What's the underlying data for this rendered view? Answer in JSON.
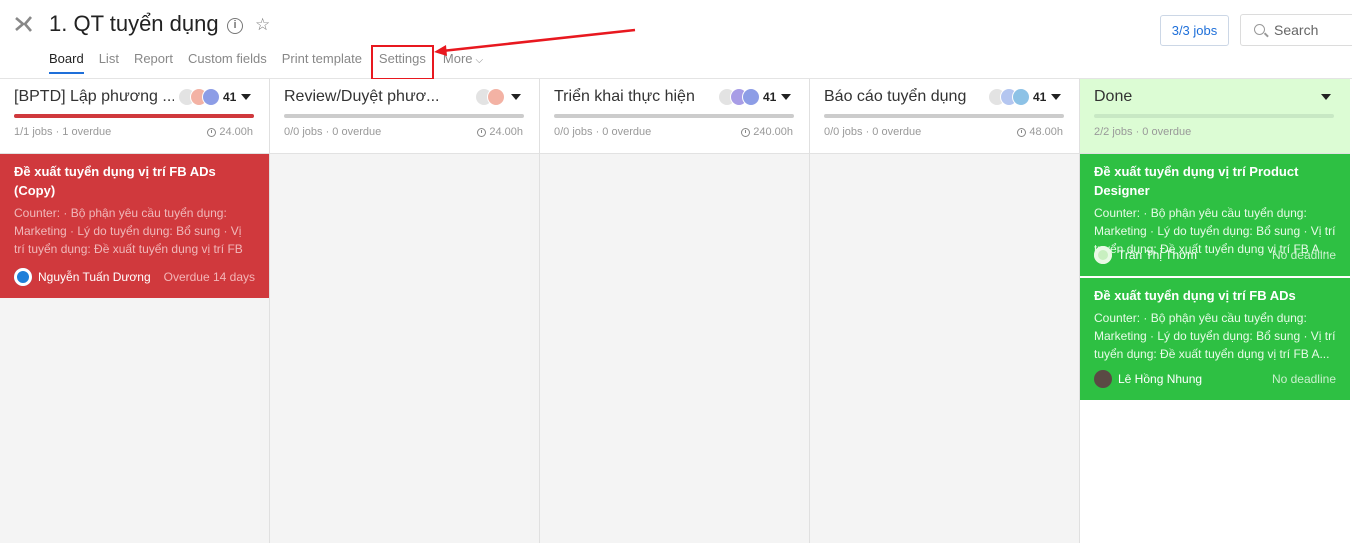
{
  "header": {
    "title": "1. QT tuyển dụng",
    "info_icon": "info-icon",
    "star_icon": "star-icon",
    "tabs": [
      {
        "label": "Board",
        "active": true
      },
      {
        "label": "List"
      },
      {
        "label": "Report"
      },
      {
        "label": "Custom fields"
      },
      {
        "label": "Print template"
      },
      {
        "label": "Settings"
      },
      {
        "label": "More"
      }
    ],
    "jobs_button": "3/3 jobs",
    "search_placeholder": "Search"
  },
  "colors": {
    "accent": "#1e6fd9",
    "overdue_card": "#d0393d",
    "done_card": "#2ec043",
    "done_header": "#dcfcd4",
    "annotation": "#e8181f"
  },
  "columns": [
    {
      "title": "[BPTD] Lập phương ...",
      "member_count": "41",
      "stats": "1/1 jobs · 1 overdue",
      "hours": "24.00h",
      "progress": 1.0,
      "progress_color": "#d0393d",
      "cards": [
        {
          "title": "Đề xuất tuyển dụng vị trí FB ADs (Copy)",
          "desc": "Counter: · Bộ phận yêu cầu tuyển dụng: Marketing · Lý do tuyển dụng: Bổ sung · Vị trí tuyển dụng: Đề xuất tuyển dụng vị trí FB A...",
          "user": "Nguyễn Tuấn Dương",
          "status": "Overdue 14 days"
        }
      ]
    },
    {
      "title": "Review/Duyệt phươ...",
      "member_count": "",
      "stats": "0/0 jobs · 0 overdue",
      "hours": "24.00h",
      "progress": 0,
      "cards": []
    },
    {
      "title": "Triển khai thực hiện",
      "member_count": "41",
      "stats": "0/0 jobs · 0 overdue",
      "hours": "240.00h",
      "progress": 0,
      "cards": []
    },
    {
      "title": "Báo cáo tuyển dụng",
      "member_count": "41",
      "stats": "0/0 jobs · 0 overdue",
      "hours": "48.00h",
      "progress": 0,
      "cards": []
    },
    {
      "title": "Done",
      "member_count": "",
      "stats": "2/2 jobs · 0 overdue",
      "hours": "",
      "progress": 0,
      "cards": [
        {
          "title": "Đề xuất tuyển dụng vị trí Product Designer",
          "desc": "Counter: · Bộ phận yêu cầu tuyển dụng: Marketing · Lý do tuyển dụng: Bổ sung · Vị trí tuyển dụng: Đề xuất tuyển dụng vị trí FB A...",
          "user": "Trần Thị Thơm",
          "status": "No deadline"
        },
        {
          "title": "Đề xuất tuyển dụng vị trí FB ADs",
          "desc": "Counter: · Bộ phận yêu cầu tuyển dụng: Marketing · Lý do tuyển dụng: Bổ sung · Vị trí tuyển dụng: Đề xuất tuyển dụng vị trí FB A...",
          "user": "Lê Hồng Nhung",
          "status": "No deadline"
        }
      ]
    }
  ]
}
